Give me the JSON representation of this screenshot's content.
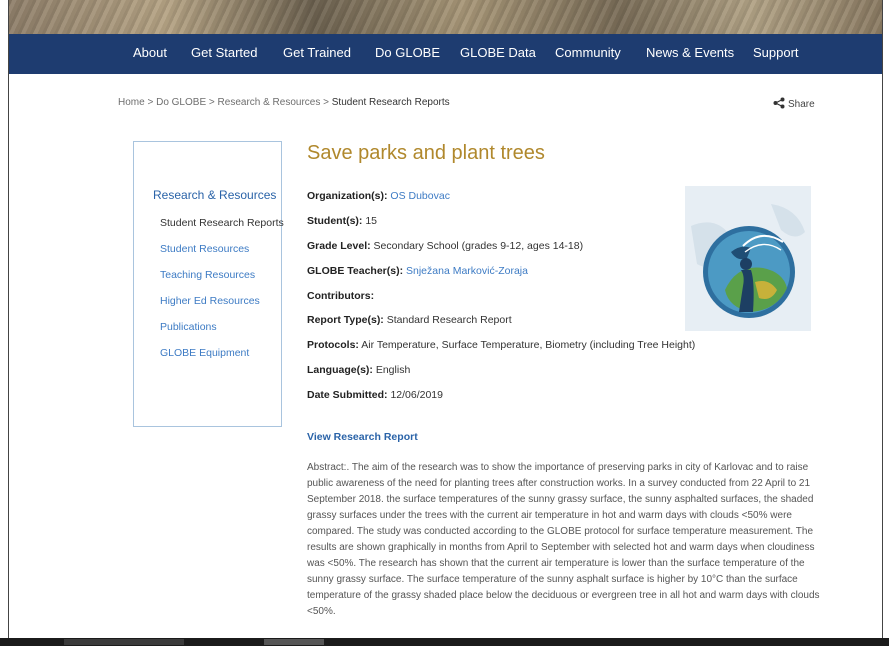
{
  "nav": {
    "items": [
      "About",
      "Get Started",
      "Get Trained",
      "Do GLOBE",
      "GLOBE Data",
      "Community",
      "News & Events",
      "Support"
    ],
    "bar_color": "#1e3c70"
  },
  "breadcrumb": {
    "home": "Home",
    "section": "Do GLOBE",
    "subsection": "Research & Resources",
    "current": "Student Research Reports",
    "separator": ">"
  },
  "share": {
    "label": "Share",
    "icon": "share-icon"
  },
  "sidebar": {
    "heading": "Research & Resources",
    "items": [
      {
        "label": "Student Research Reports",
        "active": true
      },
      {
        "label": "Student Resources",
        "active": false
      },
      {
        "label": "Teaching Resources",
        "active": false
      },
      {
        "label": "Higher Ed Resources",
        "active": false
      },
      {
        "label": "Publications",
        "active": false
      },
      {
        "label": "GLOBE Equipment",
        "active": false
      }
    ]
  },
  "report": {
    "title": "Save parks and plant trees",
    "organization_label": "Organization(s):",
    "organization": "OS Dubovac",
    "students_label": "Student(s):",
    "students": "15",
    "grade_label": "Grade Level:",
    "grade": "Secondary School (grades 9-12, ages 14-18)",
    "teacher_label": "GLOBE Teacher(s):",
    "teacher": "Snježana Marković-Zoraja",
    "contributors_label": "Contributors:",
    "report_type_label": "Report Type(s):",
    "report_type": "Standard Research Report",
    "protocols_label": "Protocols:",
    "protocols": "Air Temperature, Surface Temperature, Biometry (including Tree Height)",
    "language_label": "Language(s):",
    "language": "English",
    "date_label": "Date Submitted:",
    "date": "12/06/2019",
    "view_report": "View Research Report",
    "abstract": "Abstract:. The aim of the research was to show the importance of preserving parks in city of Karlovac and to raise public awareness of the need for planting trees after construction works. In a survey conducted from 22 April to 21 September 2018. the surface temperatures of the sunny grassy surface, the sunny asphalted surfaces, the shaded grassy surfaces under the trees with the current air temperature in hot and warm days with clouds <50% were compared. The study was conducted according to the GLOBE protocol for surface temperature measurement. The results are shown graphically in months from April to September with selected hot and warm days when cloudiness was <50%. The research has shown that the current air temperature is lower than the surface temperature of the sunny grassy surface. The surface temperature of the sunny asphalt surface is higher by 10°C than the surface temperature of the grassy shaded place below the deciduous or evergreen tree in all hot and warm days with clouds <50%."
  },
  "colors": {
    "title": "#b0882c",
    "link": "#3d7bc4",
    "heading": "#2a63a8"
  }
}
